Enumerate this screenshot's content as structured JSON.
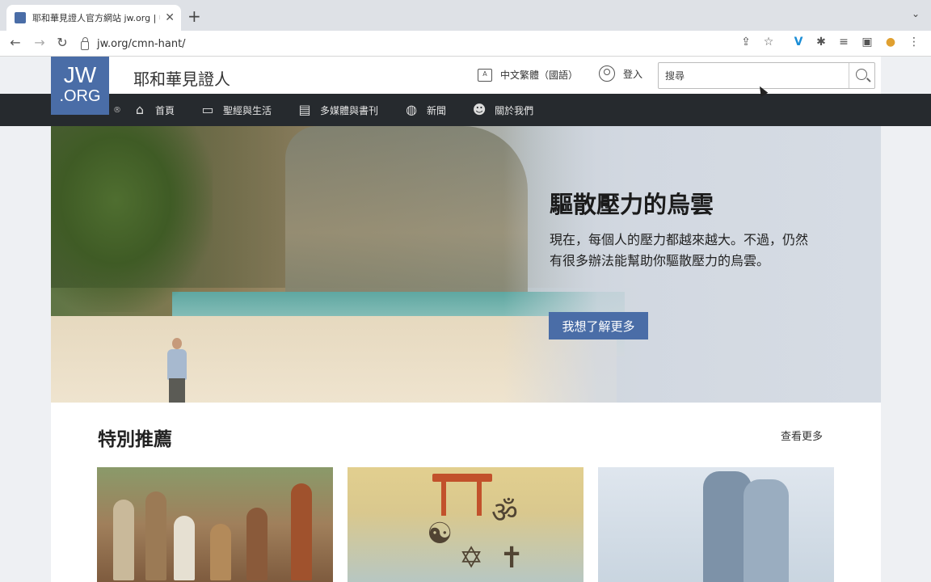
{
  "browser": {
    "tab_title": "耶和華見證人官方網站 jw.org | 中文繁體",
    "tab_close": "✕",
    "new_tab": "+",
    "tab_menu": "⌄",
    "url": "jw.org/cmn-hant/",
    "back": "←",
    "forward": "→",
    "reload": "↻"
  },
  "header": {
    "logo_line1": "JW",
    "logo_line2": ".ORG",
    "site_name": "耶和華見證人",
    "language_label": "中文繁體（國語）",
    "login_label": "登入",
    "search_placeholder": "搜尋"
  },
  "nav": {
    "registered": "®",
    "items": [
      {
        "label": "首頁",
        "icon": "home-icon"
      },
      {
        "label": "聖經與生活",
        "icon": "bible-icon"
      },
      {
        "label": "多媒體與書刊",
        "icon": "media-icon"
      },
      {
        "label": "新聞",
        "icon": "globe-icon"
      },
      {
        "label": "關於我們",
        "icon": "people-icon"
      }
    ]
  },
  "hero": {
    "title": "驅散壓力的烏雲",
    "text": "現在，每個人的壓力都越來越大。不過，仍然有很多辦法能幫助你驅散壓力的烏雲。",
    "button": "我想了解更多"
  },
  "featured": {
    "title": "特別推薦",
    "see_more": "查看更多",
    "card2_glyph_om": "ॐ",
    "card2_glyph_yinyang": "☯",
    "card2_glyph_star": "✡",
    "card2_glyph_cross": "✝"
  },
  "colors": {
    "brand": "#4a6da7",
    "navbar": "#262a2e"
  }
}
